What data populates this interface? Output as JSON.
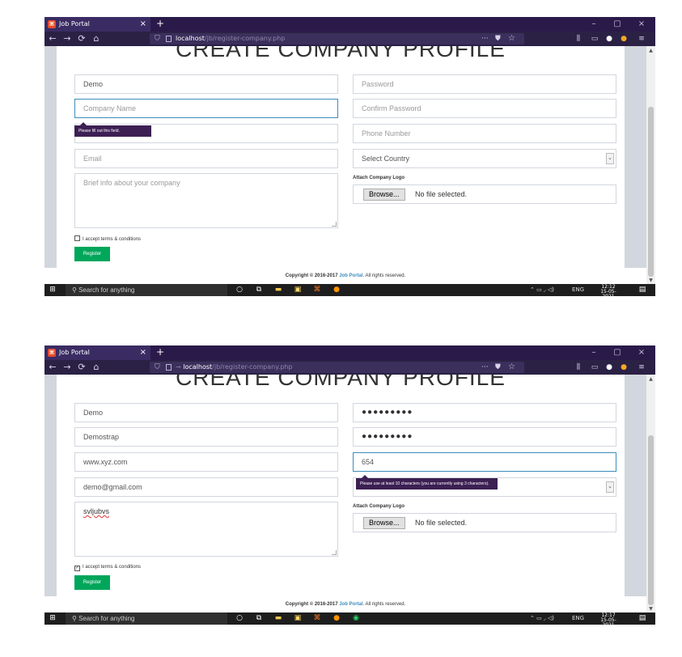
{
  "screens": [
    {
      "browser": {
        "tab_title": "Job Portal",
        "url_host": "localhost",
        "url_path": "/jb/register-company.php",
        "url_extra_icon": ""
      },
      "page": {
        "title": "CREATE COMPANY PROFILE",
        "left_fields": [
          {
            "value": "Demo",
            "placeholder": ""
          },
          {
            "value": "",
            "placeholder": "Company Name"
          },
          {
            "value": "",
            "placeholder": ""
          },
          {
            "value": "",
            "placeholder": "Email"
          }
        ],
        "right_fields": [
          {
            "value": "",
            "placeholder": "Password"
          },
          {
            "value": "",
            "placeholder": "Confirm Password"
          },
          {
            "value": "",
            "placeholder": "Phone Number"
          },
          {
            "value": "Select Country",
            "placeholder": ""
          }
        ],
        "brief": {
          "value": "",
          "placeholder": "Brief info about your company"
        },
        "logo_label": "Attach Company Logo",
        "browse_label": "Browse...",
        "file_status": "No file selected.",
        "terms_label": "I accept terms & conditions",
        "terms_checked": false,
        "register_label": "Register",
        "tooltip": "Please fill out this field."
      },
      "footer": {
        "prefix": "Copyright © 2016-2017 ",
        "link": "Job Portal",
        "suffix": ". All rights reserved."
      },
      "taskbar": {
        "search_placeholder": "Search for anything",
        "time": "12:12",
        "date": "15-05-2021",
        "lang": "ENG",
        "whatsapp": false
      }
    },
    {
      "browser": {
        "tab_title": "Job Portal",
        "url_host": "localhost",
        "url_path": "/jb/register-company.php",
        "url_extra_icon": "⊸"
      },
      "page": {
        "title": "CREATE COMPANY PROFILE",
        "left_fields": [
          {
            "value": "Demo",
            "placeholder": ""
          },
          {
            "value": "Demostrap",
            "placeholder": ""
          },
          {
            "value": "www.xyz.com",
            "placeholder": ""
          },
          {
            "value": "demo@gmail.com",
            "placeholder": ""
          }
        ],
        "right_fields": [
          {
            "value": "●●●●●●●●●",
            "placeholder": ""
          },
          {
            "value": "●●●●●●●●●",
            "placeholder": ""
          },
          {
            "value": "654",
            "placeholder": ""
          },
          {
            "value": "",
            "placeholder": ""
          }
        ],
        "brief": {
          "value": "svljubvs",
          "placeholder": ""
        },
        "logo_label": "Attach Company Logo",
        "browse_label": "Browse...",
        "file_status": "No file selected.",
        "terms_label": "I accept terms & conditions",
        "terms_checked": true,
        "register_label": "Register",
        "tooltip": "Please use at least 10 characters (you are currently using 3 characters)."
      },
      "footer": {
        "prefix": "Copyright © 2016-2017 ",
        "link": "Job Portal",
        "suffix": ". All rights reserved."
      },
      "taskbar": {
        "search_placeholder": "Search for anything",
        "time": "12:17",
        "date": "15-05-2021",
        "lang": "ENG",
        "whatsapp": true
      }
    }
  ],
  "icons": {
    "back": "←",
    "forward": "→",
    "reload": "⟳",
    "home": "⌂",
    "shield": "⛉",
    "dots": "···",
    "pocket": "⛊",
    "star": "☆",
    "library": "⫼",
    "sidebar": "▭",
    "account": "●",
    "menu": "≡",
    "close": "×",
    "new_tab": "+",
    "minimize": "–",
    "maximize": "▢",
    "caret": "⌄",
    "windows": "⊞",
    "search": "⚲",
    "cortana": "○",
    "taskview": "⧉"
  },
  "colors": {
    "register_button": "#00a65a",
    "tooltip_bg": "#3c1f53",
    "page_bg": "#d2d6de",
    "link": "#3c8dbc",
    "focus_border": "#3c8dbc"
  }
}
